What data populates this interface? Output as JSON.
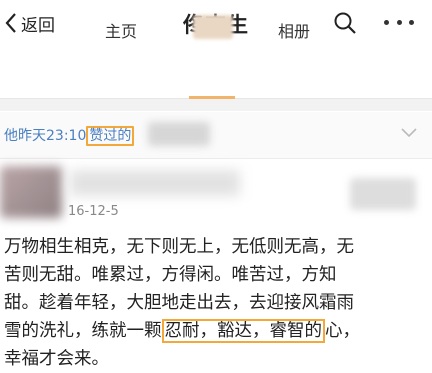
{
  "nav": {
    "back_label": "返回",
    "title": "佟吉生"
  },
  "tabs": {
    "home": "主页",
    "album": "相册"
  },
  "like": {
    "time_prefix": "他昨天23:10",
    "highlight": "赞过的"
  },
  "post": {
    "date": "16-12-5",
    "lines": [
      "万物相生相克，无下则无上，无低则无高，无",
      "苦则无甜。唯累过，方得闲。唯苦过，方知",
      "甜。趁着年轻，大胆地走出去，去迎接风霜雨",
      "雪的洗礼，练就一颗",
      "忍耐，豁达，睿智的",
      "心，",
      "幸福才会来。"
    ]
  },
  "colors": {
    "accent_orange": "#f2a83a",
    "link_blue": "#4a7fc1"
  }
}
